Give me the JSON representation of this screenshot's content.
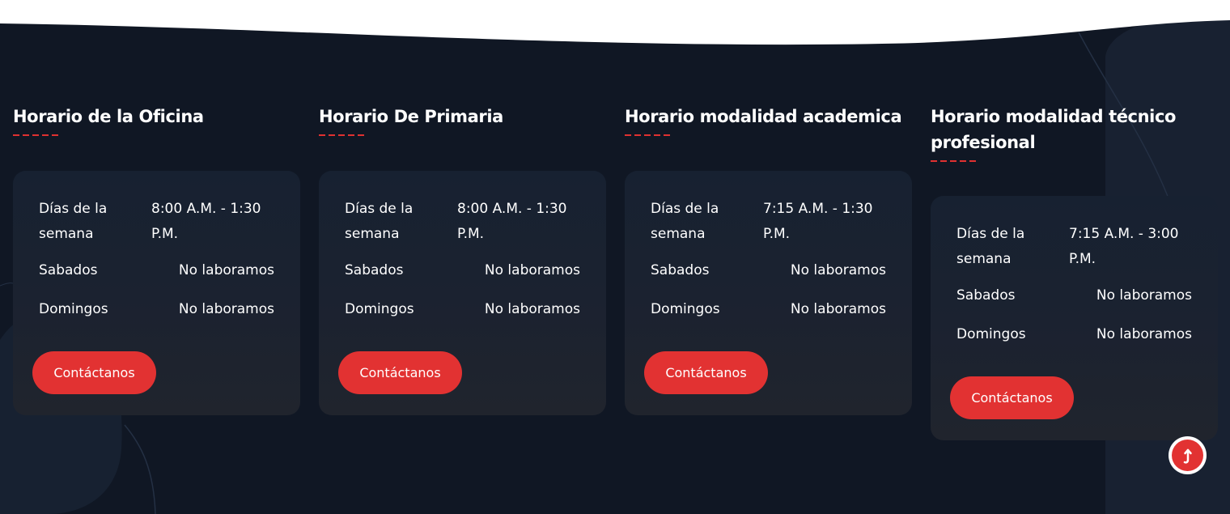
{
  "schedules": [
    {
      "title": "Horario de la Oficina",
      "rows": [
        {
          "label": "Días de la semana",
          "value": "8:00 A.M. - 1:30 P.M."
        },
        {
          "label": "Sabados",
          "value": "No laboramos"
        },
        {
          "label": "Domingos",
          "value": "No laboramos"
        }
      ],
      "button": "Contáctanos"
    },
    {
      "title": "Horario De Primaria",
      "rows": [
        {
          "label": "Días de la semana",
          "value": "8:00 A.M. - 1:30 P.M."
        },
        {
          "label": "Sabados",
          "value": "No laboramos"
        },
        {
          "label": "Domingos",
          "value": "No laboramos"
        }
      ],
      "button": "Contáctanos"
    },
    {
      "title": "Horario modalidad academica",
      "rows": [
        {
          "label": "Días de la semana",
          "value": "7:15 A.M. - 1:30 P.M."
        },
        {
          "label": "Sabados",
          "value": "No laboramos"
        },
        {
          "label": "Domingos",
          "value": "No laboramos"
        }
      ],
      "button": "Contáctanos"
    },
    {
      "title": "Horario modalidad técnico profesional",
      "rows": [
        {
          "label": "Días de la semana",
          "value": "7:15 A.M. - 3:00 P.M."
        },
        {
          "label": "Sabados",
          "value": "No laboramos"
        },
        {
          "label": "Domingos",
          "value": "No laboramos"
        }
      ],
      "button": "Contáctanos"
    }
  ],
  "scroll_top": {
    "icon": "arrow-up-icon"
  },
  "colors": {
    "background": "#101724",
    "card": "#1b2230",
    "accent": "#e23232",
    "text": "#ffffff"
  }
}
